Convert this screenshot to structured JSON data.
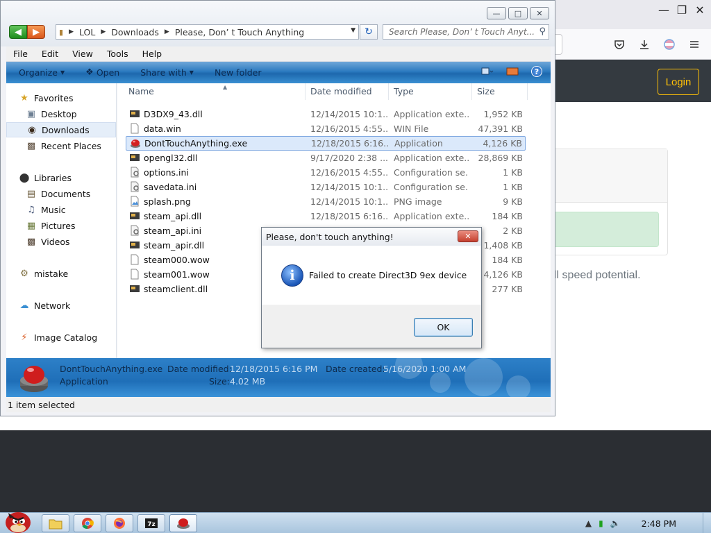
{
  "browser": {
    "login_label": "Login",
    "speed_text": "ll speed potential."
  },
  "explorer": {
    "address": {
      "crumbs": [
        "LOL",
        "Downloads",
        "Please, Don’ t Touch Anything"
      ]
    },
    "search_placeholder": "Search Please, Don’ t Touch Anyt...",
    "menu": [
      "File",
      "Edit",
      "View",
      "Tools",
      "Help"
    ],
    "commands": {
      "organize": "Organize",
      "open": "Open",
      "share_with": "Share with",
      "new_folder": "New folder"
    },
    "nav": {
      "favorites": "Favorites",
      "desktop": "Desktop",
      "downloads": "Downloads",
      "recent_places": "Recent Places",
      "libraries": "Libraries",
      "documents": "Documents",
      "music": "Music",
      "pictures": "Pictures",
      "videos": "Videos",
      "mistake": "mistake",
      "network": "Network",
      "image_catalog": "Image Catalog"
    },
    "columns": {
      "name": "Name",
      "date_modified": "Date modified",
      "type": "Type",
      "size": "Size"
    },
    "files": [
      {
        "name": "D3DX9_43.dll",
        "date": "12/14/2015 10:1...",
        "type": "Application exte...",
        "size": "1,952 KB",
        "icon": "dll-icon"
      },
      {
        "name": "data.win",
        "date": "12/16/2015 4:55...",
        "type": "WIN File",
        "size": "47,391 KB",
        "icon": "file-icon"
      },
      {
        "name": "DontTouchAnything.exe",
        "date": "12/18/2015 6:16...",
        "type": "Application",
        "size": "4,126 KB",
        "icon": "red-button-icon"
      },
      {
        "name": "opengl32.dll",
        "date": "9/17/2020 2:38 ...",
        "type": "Application exte...",
        "size": "28,869 KB",
        "icon": "dll-icon"
      },
      {
        "name": "options.ini",
        "date": "12/16/2015 4:55...",
        "type": "Configuration se...",
        "size": "1 KB",
        "icon": "ini-icon"
      },
      {
        "name": "savedata.ini",
        "date": "12/14/2015 10:1...",
        "type": "Configuration se...",
        "size": "1 KB",
        "icon": "ini-icon"
      },
      {
        "name": "splash.png",
        "date": "12/14/2015 10:1...",
        "type": "PNG image",
        "size": "9 KB",
        "icon": "image-icon"
      },
      {
        "name": "steam_api.dll",
        "date": "12/18/2015 6:16...",
        "type": "Application exte...",
        "size": "184 KB",
        "icon": "dll-icon"
      },
      {
        "name": "steam_api.ini",
        "date": "",
        "type": "",
        "size": "2 KB",
        "icon": "ini-icon"
      },
      {
        "name": "steam_apir.dll",
        "date": "",
        "type": "",
        "size": "1,408 KB",
        "icon": "dll-icon"
      },
      {
        "name": "steam000.wow",
        "date": "",
        "type": "",
        "size": "184 KB",
        "icon": "file-icon"
      },
      {
        "name": "steam001.wow",
        "date": "",
        "type": "",
        "size": "4,126 KB",
        "icon": "file-icon"
      },
      {
        "name": "steamclient.dll",
        "date": "",
        "type": "",
        "size": "277 KB",
        "icon": "dll-icon"
      }
    ],
    "details": {
      "name": "DontTouchAnything.exe",
      "date_modified_label": "Date modified:",
      "date_modified_value": "12/18/2015 6:16 PM",
      "date_created_label": "Date created:",
      "date_created_value": "5/16/2020 1:00 AM",
      "type": "Application",
      "size_label": "Size:",
      "size_value": "4.02 MB"
    },
    "status": "1 item selected"
  },
  "dialog": {
    "title": "Please, don't touch anything!",
    "message": "Failed to create Direct3D 9ex device",
    "ok_label": "OK"
  },
  "taskbar": {
    "clock": "2:48 PM"
  },
  "colors": {
    "accent_blue": "#1f6fb8",
    "login_yellow": "#ffc107",
    "selection": "#dbe9fb",
    "header_dark": "#343a40"
  }
}
